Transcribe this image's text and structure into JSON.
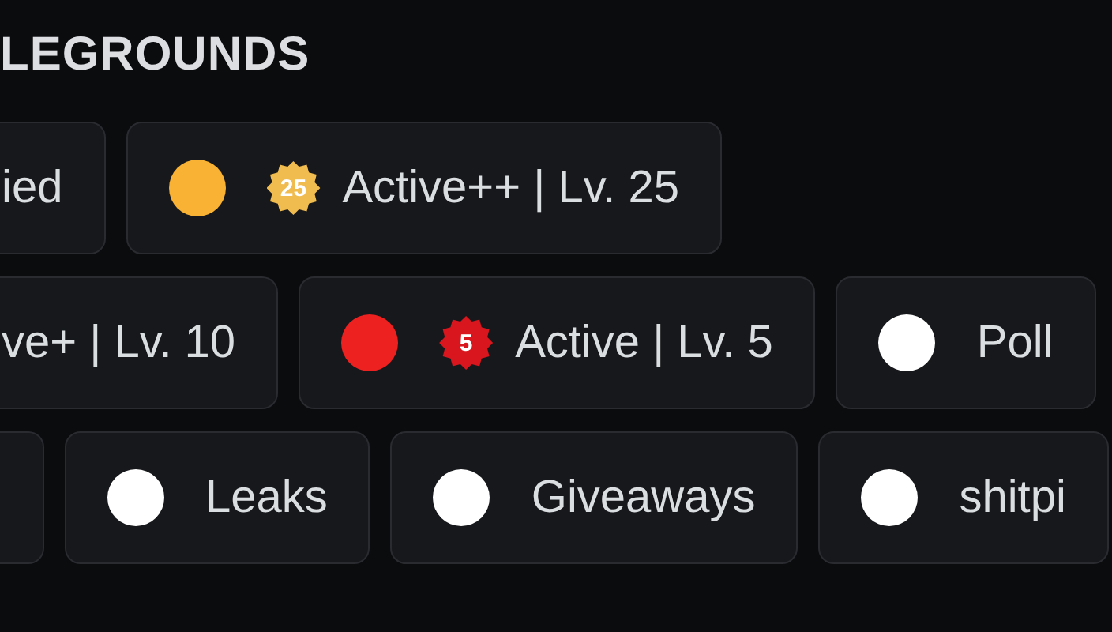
{
  "section_title": "LEGROUNDS",
  "rows": [
    {
      "chips": [
        {
          "kind": "cut",
          "label": "ied"
        },
        {
          "kind": "role",
          "label": "Active++ | Lv. 25",
          "color": "#f9b234",
          "badge": {
            "text": "25",
            "color": "#f0bb4f"
          }
        }
      ]
    },
    {
      "chips": [
        {
          "kind": "cut",
          "label": "ve+ | Lv. 10"
        },
        {
          "kind": "role",
          "label": "Active | Lv. 5",
          "color": "#ee2121",
          "badge": {
            "text": "5",
            "color": "#d9161e"
          }
        },
        {
          "kind": "role",
          "label": "Poll",
          "color": "#ffffff"
        }
      ]
    },
    {
      "chips": [
        {
          "kind": "cut"
        },
        {
          "kind": "role",
          "label": "Leaks",
          "color": "#ffffff"
        },
        {
          "kind": "role",
          "label": "Giveaways",
          "color": "#ffffff"
        },
        {
          "kind": "role",
          "label": "shitpi",
          "color": "#ffffff"
        }
      ]
    }
  ]
}
